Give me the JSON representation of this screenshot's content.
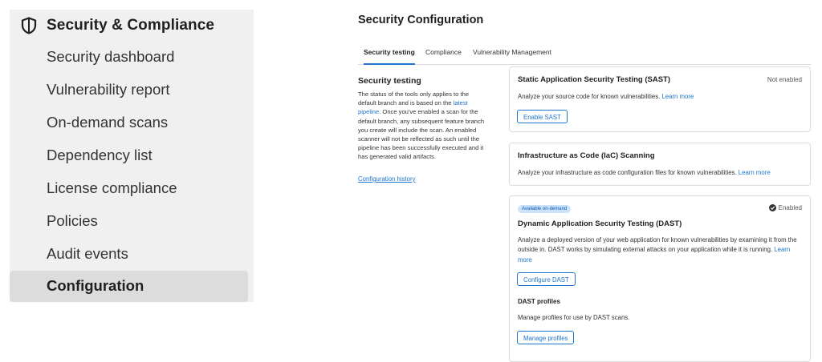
{
  "sidebar": {
    "section_title": "Security & Compliance",
    "items": [
      {
        "label": "Security dashboard"
      },
      {
        "label": "Vulnerability report"
      },
      {
        "label": "On-demand scans"
      },
      {
        "label": "Dependency list"
      },
      {
        "label": "License compliance"
      },
      {
        "label": "Policies"
      },
      {
        "label": "Audit events"
      },
      {
        "label": "Configuration",
        "active": true
      }
    ]
  },
  "main": {
    "title": "Security Configuration",
    "tabs": [
      {
        "label": "Security testing",
        "active": true
      },
      {
        "label": "Compliance"
      },
      {
        "label": "Vulnerability Management"
      }
    ],
    "side": {
      "title": "Security testing",
      "desc_before_link": "The status of the tools only applies to the default branch and is based on the ",
      "desc_link": "latest pipeline",
      "desc_after_link": ". Once you've enabled a scan for the default branch, any subsequent feature branch you create will include the scan. An enabled scanner will not be reflected as such until the pipeline has been successfully executed and it has generated valid artifacts.",
      "history_link": "Configuration history"
    },
    "cards": {
      "sast": {
        "title": "Static Application Security Testing (SAST)",
        "status": "Not enabled",
        "description": "Analyze your source code for known vulnerabilities.",
        "learn_more": "Learn more",
        "button": "Enable SAST"
      },
      "iac": {
        "title": "Infrastructure as Code (IaC) Scanning",
        "description": "Analyze your infrastructure as code configuration files for known vulnerabilities.",
        "learn_more": "Learn more"
      },
      "dast": {
        "badge": "Available on-demand",
        "status": "Enabled",
        "title": "Dynamic Application Security Testing (DAST)",
        "description": "Analyze a deployed version of your web application for known vulnerabilities by examining it from the outside in. DAST works by simulating external attacks on your application while it is running.",
        "learn_more": "Learn more",
        "button": "Configure DAST",
        "profiles_title": "DAST profiles",
        "profiles_description": "Manage profiles for use by DAST scans.",
        "profiles_button": "Manage profiles"
      }
    }
  },
  "colors": {
    "link": "#1f75cb",
    "sidebar_bg": "#f0f0f0",
    "active_item_bg": "#dcdcdc",
    "badge_bg": "#cbe2f9"
  }
}
